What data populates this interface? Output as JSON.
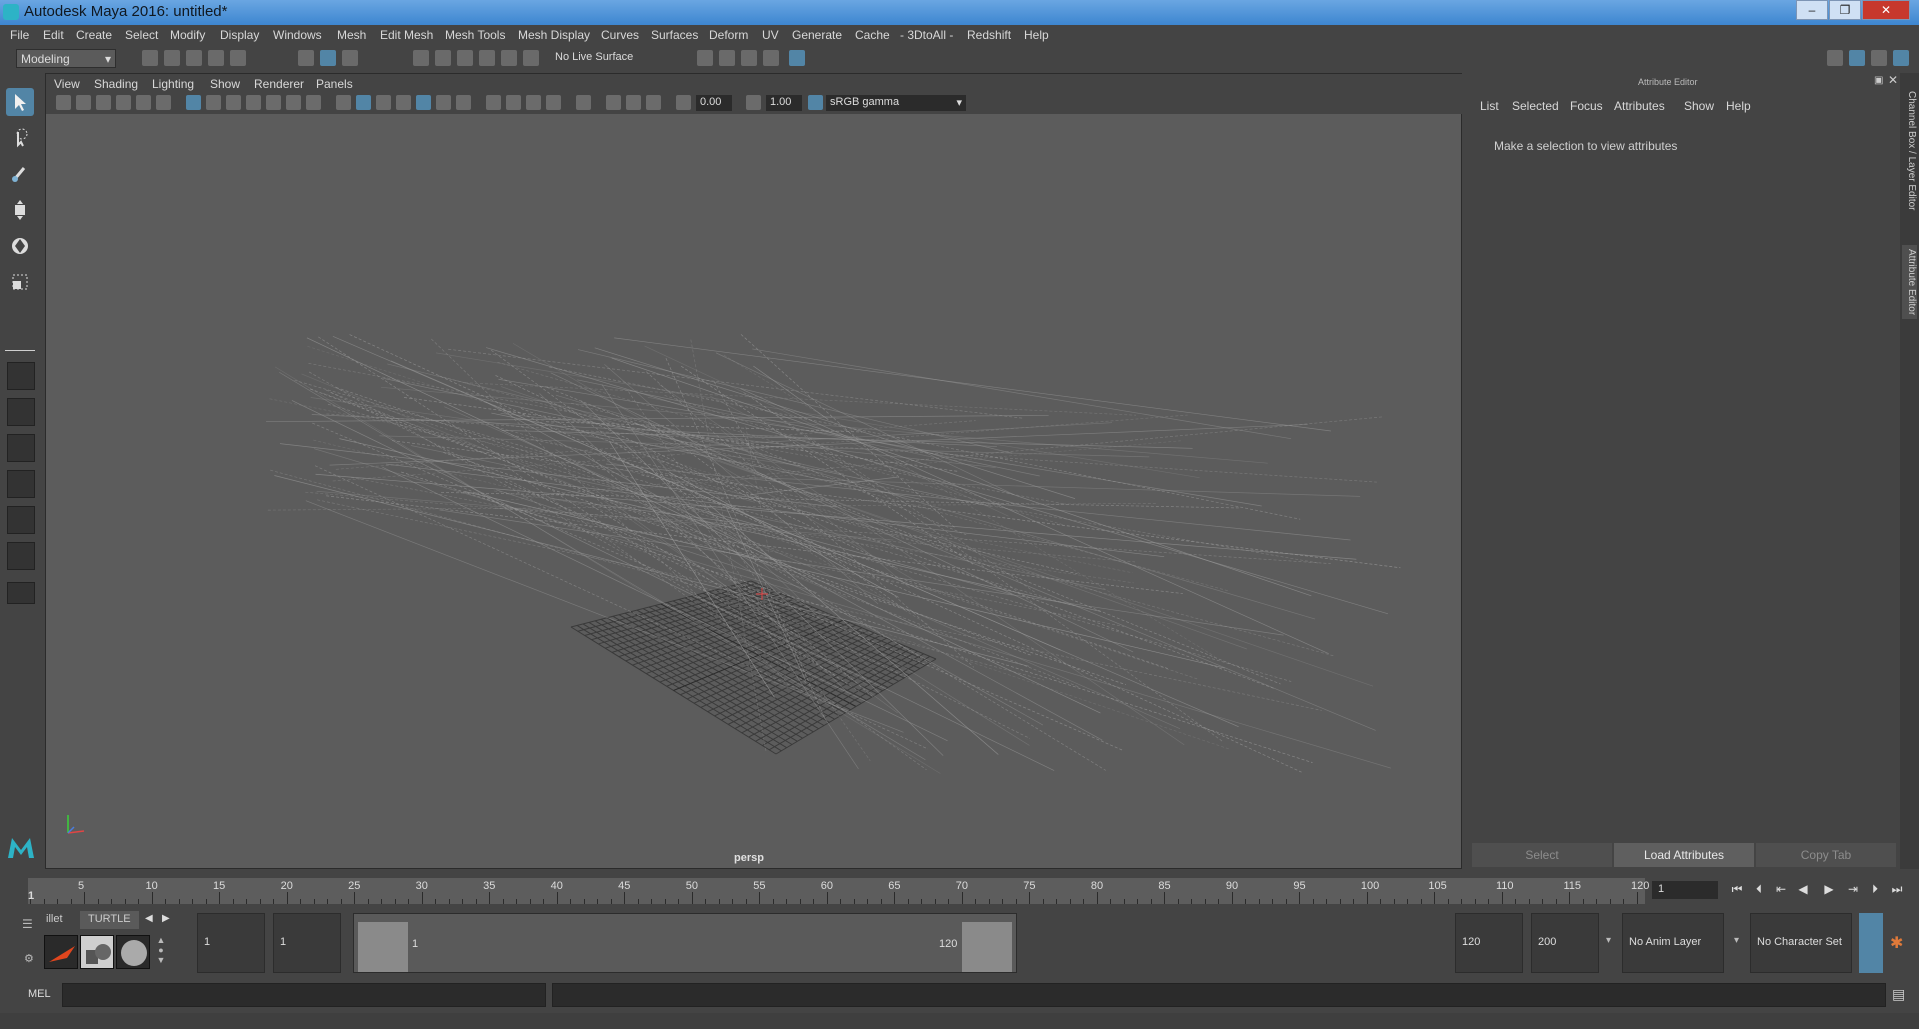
{
  "window": {
    "title": "Autodesk Maya 2016: untitled*",
    "controls": [
      "–",
      "❐",
      "✕"
    ]
  },
  "menubar": [
    "File",
    "Edit",
    "Create",
    "Select",
    "Modify",
    "Display",
    "Windows",
    "Mesh",
    "Edit Mesh",
    "Mesh Tools",
    "Mesh Display",
    "Curves",
    "Surfaces",
    "Deform",
    "UV",
    "Generate",
    "Cache",
    "- 3DtoAll -",
    "Redshift",
    "Help"
  ],
  "statusline": {
    "mode": "Modeling",
    "live_surface": "No Live Surface"
  },
  "viewport": {
    "panel_menu": [
      "View",
      "Shading",
      "Lighting",
      "Show",
      "Renderer",
      "Panels"
    ],
    "exposure": "0.00",
    "gamma": "1.00",
    "colorspace": "sRGB gamma",
    "camera_label": "persp"
  },
  "attribute_editor": {
    "title": "Attribute Editor",
    "menu": [
      "List",
      "Selected",
      "Focus",
      "Attributes",
      "Show",
      "Help"
    ],
    "message": "Make a selection to view attributes",
    "buttons": [
      "Select",
      "Load Attributes",
      "Copy Tab"
    ],
    "side_tabs": [
      "Channel Box / Layer Editor",
      "Attribute Editor"
    ]
  },
  "timeslider": {
    "start_tick": "1",
    "tick_labels": [
      "5",
      "10",
      "15",
      "20",
      "25",
      "30",
      "35",
      "40",
      "45",
      "50",
      "55",
      "60",
      "65",
      "70",
      "75",
      "80",
      "85",
      "90",
      "95",
      "100",
      "105",
      "110",
      "115",
      "120"
    ],
    "current_frame": "1"
  },
  "range": {
    "start": "1",
    "playback_start": "1",
    "range_start_label": "1",
    "range_end_label": "120",
    "playback_end": "120",
    "end": "200",
    "anim_layer": "No Anim Layer",
    "character_set": "No Character Set"
  },
  "shelf": {
    "tabs": [
      "illet",
      "TURTLE"
    ]
  },
  "cmdline": {
    "label": "MEL"
  },
  "colors": {
    "accent": "#5285a6",
    "viewport_bg": "#5c5c5c",
    "panel_bg": "#444444"
  }
}
